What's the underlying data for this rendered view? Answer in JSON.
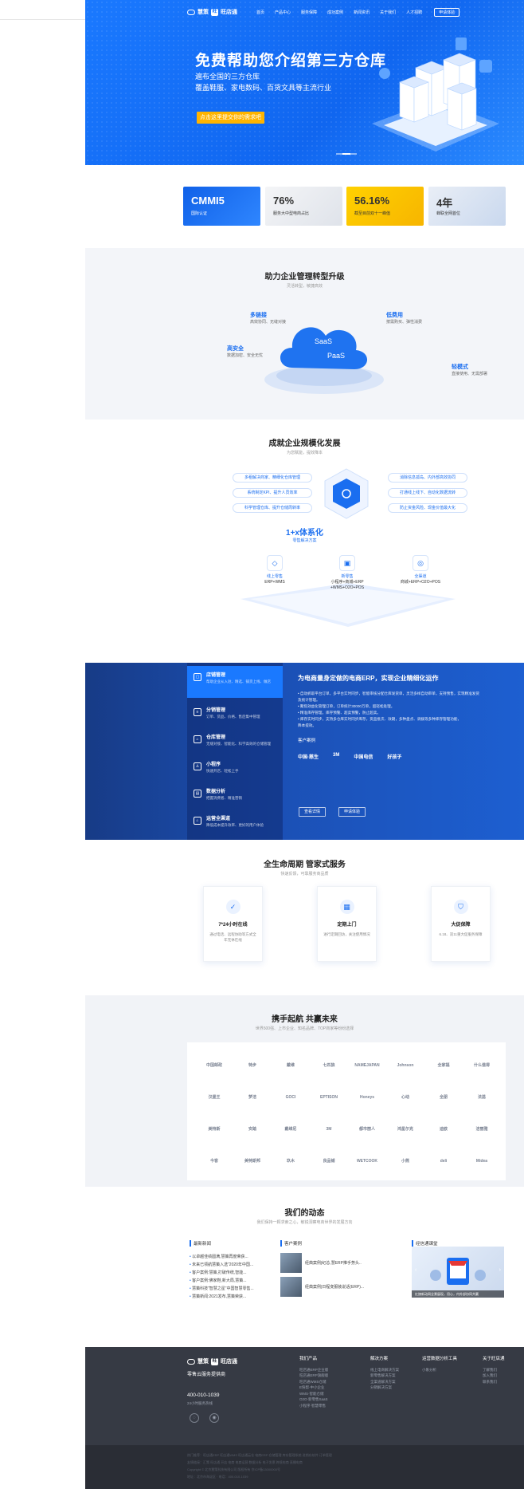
{
  "nav": {
    "brand1": "慧策",
    "brand2": "旺店通",
    "items": [
      "首页",
      "产品中心",
      "服务保障",
      "成功案例",
      "新闻资讯",
      "关于我们",
      "人才招聘"
    ],
    "apply": "申请体验"
  },
  "hero": {
    "title": "免费帮助您介绍第三方仓库",
    "line1": "遍布全国的三方仓库",
    "line2": "覆盖鞋服、家电数码、百货文具等主流行业",
    "cta": "点击这里提交你的需求吧"
  },
  "stats": [
    {
      "value": "CMMI5",
      "label": "国际认证"
    },
    {
      "value": "76%",
      "label": "服务大中型电商占比"
    },
    {
      "value": "56.16%",
      "label": "截至目前双十一峰值"
    },
    {
      "value": "4年",
      "label": "蝉联全网首位"
    }
  ],
  "saas": {
    "title": "助力企业管理转型升级",
    "subtitle": "灵活转型，敏捷高效",
    "cloud1": "SaaS",
    "cloud2": "PaaS",
    "features": [
      {
        "title": "多链接",
        "desc": "高效协同、无缝对接"
      },
      {
        "title": "低费用",
        "desc": "按需购买、弹性消费"
      },
      {
        "title": "高安全",
        "desc": "数据加密、安全无忧"
      },
      {
        "title": "轻模式",
        "desc": "直接使用、无需部署"
      }
    ]
  },
  "scale": {
    "title": "成就企业规模化发展",
    "subtitle": "为您赋能，提效降本",
    "left_pills": [
      "多租解决商家、精细化仓库管理",
      "系统制定KPI、提升人员效率",
      "科学管理仓库、提升仓储周转率"
    ],
    "right_pills": [
      "消除信息孤岛、内外部高效协同",
      "打通线上线下、自动化数据流转",
      "防止资金风险、现金价值最大化"
    ],
    "system_title": "1+x体系化",
    "system_sub": "零售解决方案",
    "modules": [
      {
        "title": "线上零售",
        "desc": "ERP+WMS"
      },
      {
        "title": "新零售",
        "desc": "小程序+商城+ERP\n+WMS+O2O+POS"
      },
      {
        "title": "全渠道",
        "desc": "商城+ERP+O2O+POS"
      }
    ]
  },
  "erp": {
    "menu": [
      {
        "title": "店铺管理",
        "desc": "帮助企业从入驻、精选、铺货上线、做店"
      },
      {
        "title": "分销管理",
        "desc": "订单、货品、价格、售后集中管理"
      },
      {
        "title": "仓库管理",
        "desc": "无缝对接、智能化、科学高效的仓储管理"
      },
      {
        "title": "小程序",
        "desc": "快速开店、轻松上手"
      },
      {
        "title": "数据分析",
        "desc": "把握消费者、精准营销"
      },
      {
        "title": "运营全渠道",
        "desc": "降低成本提升效率、更好的用户体验"
      }
    ],
    "heading": "为电商量身定做的电商ERP，实现企业精细化运作",
    "points": [
      "• 自动抓取平台订单，多平台实时同步，智能审核分配仓库发货单，灵活多样自动审单，支持预售，实现精准发货",
      "  及统计管理。",
      "• 聚焦效益化管理订单，订单统计30000万单，超轻松处理。",
      "• 精准库存管理，库存预警、超卖预警，防止超卖。",
      "• 库存实时同步，支持多仓库实时同步库存，货品批次、效期，多种盘点、调拨等多种库存管理功能，",
      "  降本提效。"
    ],
    "clients_label": "客户案例",
    "clients": [
      "中国·慈生",
      "3M",
      "中国电信",
      "好孩子"
    ],
    "btn1": "查看详情",
    "btn2": "申请体验"
  },
  "life": {
    "title": "全生命周期 管家式服务",
    "subtitle": "快速反馈，可靠服务商品质",
    "cards": [
      {
        "title": "7*24小时在线",
        "desc": "通过电话、远程协助等方式全年无休在线"
      },
      {
        "title": "定期上门",
        "desc": "进行定期回访，关注使用情况"
      },
      {
        "title": "大促保障",
        "desc": "6.18、双11重大促服务保障"
      }
    ]
  },
  "partners": {
    "title": "携手起航 共赢未来",
    "subtitle": "世界500强、上市企业、知名品牌、TOP商家等纷纷选择",
    "logos": [
      "中国邮政",
      "特步",
      "戴维",
      "七匹狼",
      "NAMEJAPAN",
      "Johnson",
      "全家福",
      "什么值得",
      "汉堡王",
      "梦洁",
      "GOCI",
      "EPTISON",
      "Honeys",
      "心动",
      "全朋",
      "法蕊",
      "美特斯",
      "安踏",
      "戴维尼",
      "3M",
      "都市丽人",
      "鸿星尔克",
      "迪欧",
      "洁丽雅",
      "今客",
      "美特斯邦",
      "玖木",
      "良品铺",
      "WETCOOK",
      "小熊",
      "deli",
      "Midea"
    ]
  },
  "news": {
    "title": "我们的动态",
    "subtitle": "我们保持一颗求索之心，敏锐洞察电商世界的发展方向",
    "col1_title": "最新新闻",
    "col1_items": [
      "以卓越佳绩圆满,慧策再度荣获...",
      "未来已领航慧策入选“2020年中国...",
      "客户案例:慧策,打破传统,智能...",
      "客户案例:佛家鞋,新大局,慧策...",
      "慧策科技“智慧之星”中国智慧零售...",
      "慧策新闻:2021发布,慧策荣获..."
    ],
    "col2_title": "客户案例",
    "col2_items": [
      "经典案例|纪总,慧ERP推手势头..",
      "经典案例|日程变服装说话(ERP)..."
    ],
    "col3_title": "经信通课堂",
    "promo_caption": "红旗新动网全景展现，用心，内外部协同共赢"
  },
  "footer": {
    "brand1": "慧策",
    "brand2": "旺店通",
    "tagline": "零售云服务提供商",
    "phone": "400-010-1039",
    "phone_note": "24小时服务热线",
    "cols": [
      {
        "title": "我们产品",
        "items": [
          "旺店通ERP企业版",
          "旺店通ERP旗舰版",
          "旺店通WMS仓储",
          "E快帮·中小企业",
          "WMS·智能仓储",
          "O2O·新零售SaaS",
          "小程序·智慧零售"
        ]
      },
      {
        "title": "解决方案",
        "items": [
          "线上电商解决方案",
          "新零售解决方案",
          "全渠道解决方案",
          "分销解决方案"
        ]
      },
      {
        "title": "运营数据分析工具",
        "items": [
          "小象分析"
        ]
      },
      {
        "title": "关于旺店通",
        "items": [
          "了解我们",
          "加入我们",
          "联系我们"
        ]
      }
    ],
    "copy1": "热门推荐：旺店通ERP 旺店通WMS 旺店通云仓 电商ERP 仓储管理 库存管理系统 进销存软件 订单管理",
    "copy2": "友情链接：汇策 旺店通 开店 电商 电商运营 数据分析 电子发票 跨境电商 直播电商",
    "copy3": "Copyright © 北京慧策科技有限公司 版权所有 京ICP备13000000号",
    "copy4": "地址：北京市海淀区 · 电话：400-010-1039"
  }
}
